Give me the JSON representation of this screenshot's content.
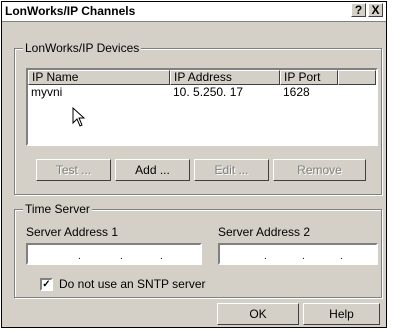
{
  "window": {
    "title": "LonWorks/IP Channels",
    "help_btn": "?",
    "close_btn": "X"
  },
  "devices_group": {
    "legend": "LonWorks/IP Devices",
    "columns": [
      "IP Name",
      "IP Address",
      "IP Port"
    ],
    "rows": [
      {
        "name": "myvni",
        "address": "10.  5.250. 17",
        "port": "1628"
      }
    ],
    "buttons": {
      "test": "Test ...",
      "add": "Add ...",
      "edit": "Edit ...",
      "remove": "Remove"
    }
  },
  "time_server": {
    "legend": "Time Server",
    "addr1_label": "Server Address 1",
    "addr2_label": "Server Address 2",
    "sntp_checkbox_label": "Do not use an SNTP server",
    "sntp_checked": true
  },
  "footer": {
    "ok": "OK",
    "help": "Help"
  }
}
